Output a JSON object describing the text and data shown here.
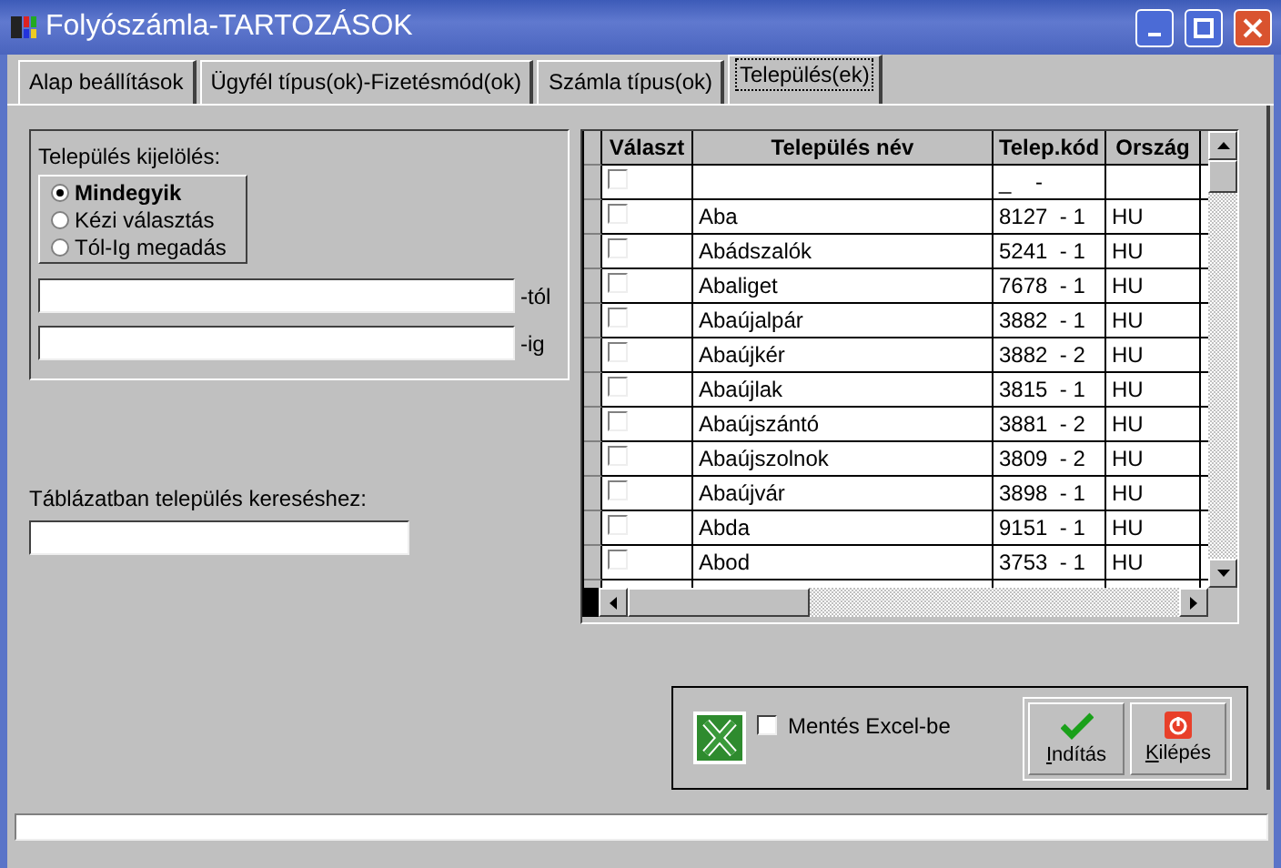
{
  "window": {
    "title": "Folyószámla-TARTOZÁSOK"
  },
  "tabs": [
    {
      "label": "Alap beállítások",
      "selected": false
    },
    {
      "label": "Ügyfél típus(ok)-Fizetésmód(ok)",
      "selected": false
    },
    {
      "label": "Számla típus(ok)",
      "selected": false
    },
    {
      "label": "Település(ek)",
      "selected": true
    }
  ],
  "selection": {
    "title": "Település kijelölés:",
    "options": [
      {
        "label": "Mindegyik",
        "selected": true
      },
      {
        "label": "Kézi választás",
        "selected": false
      },
      {
        "label": "Tól-Ig megadás",
        "selected": false
      }
    ],
    "from_suffix": "-tól",
    "to_suffix": "-ig"
  },
  "search": {
    "label": "Táblázatban település kereséshez:"
  },
  "table": {
    "columns": [
      "Választ",
      "Település név",
      "Telep.kód",
      "Ország"
    ],
    "rows": [
      {
        "checked": false,
        "code": "_    -"
      },
      {
        "checked": false,
        "name": "Aba",
        "code": "8127  - 1",
        "country": "HU"
      },
      {
        "checked": false,
        "name": "Abádszalók",
        "code": "5241  - 1",
        "country": "HU"
      },
      {
        "checked": false,
        "name": "Abaliget",
        "code": "7678  - 1",
        "country": "HU"
      },
      {
        "checked": false,
        "name": "Abaújalpár",
        "code": "3882  - 1",
        "country": "HU"
      },
      {
        "checked": false,
        "name": "Abaújkér",
        "code": "3882  - 2",
        "country": "HU"
      },
      {
        "checked": false,
        "name": "Abaújlak",
        "code": "3815  - 1",
        "country": "HU"
      },
      {
        "checked": false,
        "name": "Abaújszántó",
        "code": "3881  - 2",
        "country": "HU"
      },
      {
        "checked": false,
        "name": "Abaújszolnok",
        "code": "3809  - 2",
        "country": "HU"
      },
      {
        "checked": false,
        "name": "Abaújvár",
        "code": "3898  - 1",
        "country": "HU"
      },
      {
        "checked": false,
        "name": "Abda",
        "code": "9151  - 1",
        "country": "HU"
      },
      {
        "checked": false,
        "name": "Abod",
        "code": "3753  - 1",
        "country": "HU"
      }
    ]
  },
  "export": {
    "label": "Mentés Excel-be",
    "checked": false
  },
  "buttons": [
    {
      "label": "Indítás",
      "kind": "start"
    },
    {
      "label": "Kilépés",
      "kind": "exit"
    }
  ]
}
